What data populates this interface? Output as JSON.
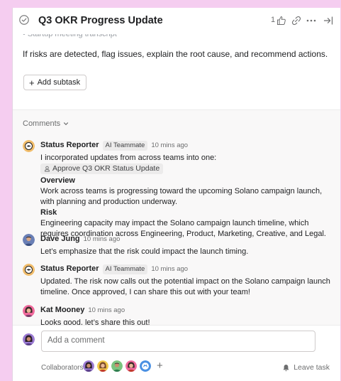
{
  "header": {
    "title": "Q3 OKR Progress Update",
    "like_count": "1",
    "icons": [
      "check-circle-icon",
      "thumbs-up-icon",
      "link-icon",
      "more-icon",
      "close-panel-icon"
    ]
  },
  "task": {
    "cut_off_line": "• Startup meeting transcript",
    "description": "If risks are detected, flag issues, explain the root cause, and recommend actions.",
    "add_subtask_label": "Add subtask"
  },
  "comments_section": {
    "toggle_label": "Comments",
    "items": [
      {
        "author": "Status Reporter",
        "badge": "AI Teammate",
        "time": "10 mins ago",
        "intro": "I incorporated updates from across teams into one:",
        "task_chip": "Approve Q3 OKR Status Update",
        "overview_heading": "Overview",
        "overview_text": "Work across teams is progressing toward the upcoming Solano campaign launch, with planning and production underway.",
        "risk_heading": "Risk",
        "risk_text": "Engineering capacity may impact the Solano campaign launch timeline, which requires coordination across Engineering, Product, Marketing, Creative, and Legal."
      },
      {
        "author": "Dave Jung",
        "time": "10 mins ago",
        "text": "Let’s emphasize that the risk could impact the launch timing."
      },
      {
        "author": "Status Reporter",
        "badge": "AI Teammate",
        "time": "10 mins ago",
        "text": "Updated. The risk now calls out the potential impact on the Solano campaign launch timeline. Once approved, I can share this out with your team!"
      },
      {
        "author": "Kat Mooney",
        "time": "10 mins ago",
        "text": "Looks good, let’s share this out!"
      }
    ]
  },
  "composer": {
    "placeholder": "Add a comment",
    "collaborators_label": "Collaborators",
    "leave_task_label": "Leave task"
  },
  "colors": {
    "page_background": "#f5cdf0",
    "ai_avatar": "#f1bd6c",
    "muted_text": "#6d6e6f"
  }
}
